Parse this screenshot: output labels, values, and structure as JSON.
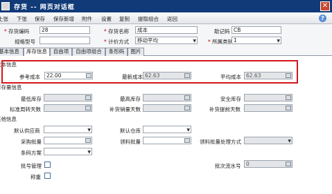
{
  "window": {
    "title": "存货 -- 网页对话框",
    "close_glyph": "✕"
  },
  "toolbar": {
    "items": [
      "上张",
      "下张",
      "保存",
      "保存新增",
      "附件",
      "设置",
      "复制",
      "提取组合",
      "返回"
    ]
  },
  "header": {
    "code_label": "存货编码",
    "code_value": "28",
    "name_label": "存货名称",
    "name_value": "成本",
    "mnemonic_label": "助记码",
    "mnemonic_value": "CB",
    "spec_label": "规格型号",
    "spec_value": "",
    "pricing_label": "计价方式",
    "pricing_value": "移动平均",
    "category_label": "所属类别",
    "category_value": "1"
  },
  "tabs": [
    "基本信息",
    "库存信息",
    "自由项",
    "自由项组合",
    "条形码",
    "图片"
  ],
  "active_tab": 1,
  "cost": {
    "section_title": "成本信息",
    "ref_cost_label": "参考成本",
    "ref_cost_value": "22.00",
    "latest_cost_label": "最新成本",
    "latest_cost_value": "62.63",
    "avg_cost_label": "平均成本",
    "avg_cost_value": "62.63"
  },
  "stock": {
    "section_title": "库存量信息",
    "min_label": "最低库存",
    "max_label": "最高库存",
    "safe_label": "安全库存",
    "cycle_label": "标准周转天数",
    "replenish_qty_label": "补货销量天数",
    "lead_days_label": "补货提前天数"
  },
  "other": {
    "section_title": "其他信息",
    "supplier_label": "默认供应商",
    "warehouse_label": "默认仓库",
    "purchase_batch_label": "采购批量",
    "issue_batch_label": "领料批量",
    "issue_method_label": "领料批量处理方式",
    "bom_label": "条码方案",
    "batch_mgmt_label": "批号管理",
    "batch_seq_label": "批次流水号",
    "batch_seq_value": "0",
    "weigh_label": "称重"
  },
  "colors": {
    "titlebar": "#103a78",
    "highlight": "#d4141a",
    "required": "#cc0000"
  }
}
